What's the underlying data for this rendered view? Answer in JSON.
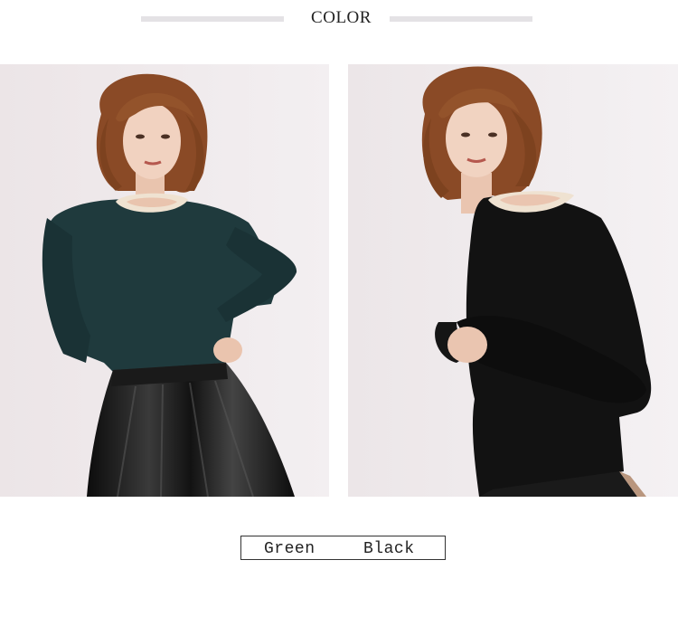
{
  "header": {
    "title": "COLOR"
  },
  "photos": [
    {
      "name": "model-green-sweater",
      "sweater_color": "#1f3a3d",
      "skirt_color": "#111111"
    },
    {
      "name": "model-black-sweater",
      "sweater_color": "#111111"
    }
  ],
  "colors": {
    "option_1": "Green",
    "option_2": "Black"
  }
}
